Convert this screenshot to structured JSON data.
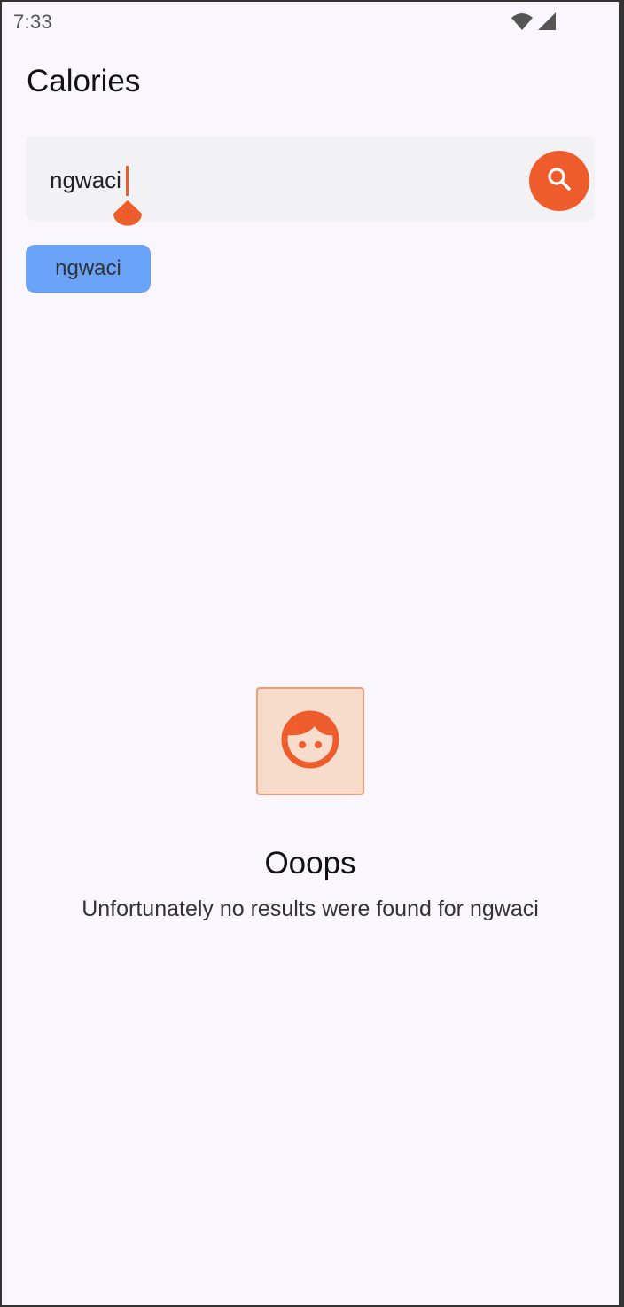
{
  "status_bar": {
    "time": "7:33",
    "icons": [
      "wifi-icon",
      "cellular-signal-icon"
    ]
  },
  "header": {
    "title": "Calories"
  },
  "search": {
    "value": "ngwaci",
    "button_icon": "search-icon"
  },
  "chips": [
    {
      "label": "ngwaci"
    }
  ],
  "empty_state": {
    "icon": "face-icon",
    "title": "Ooops",
    "message": "Unfortunately no results were found for ngwaci"
  },
  "colors": {
    "accent": "#ee5c2b",
    "chip": "#6aa3f8",
    "background": "#f9f7fd",
    "search_field": "#f2f2f4",
    "icon_box": "#f7dccc"
  }
}
